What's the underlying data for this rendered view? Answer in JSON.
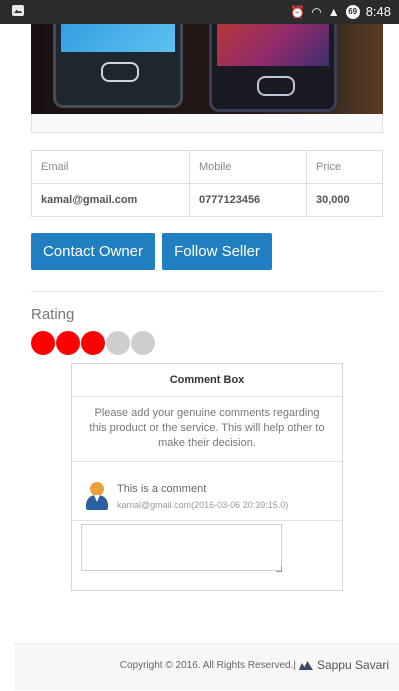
{
  "status_bar": {
    "time": "8:48",
    "battery_level": "69",
    "icons": [
      "image-icon",
      "alarm-icon",
      "wifi-icon",
      "signal-icon",
      "battery-icon"
    ]
  },
  "product": {
    "image_alt": "product-photo"
  },
  "table": {
    "headers": [
      "Email",
      "Mobile",
      "Price"
    ],
    "row": [
      "kamal@gmail.com",
      "0777123456",
      "30,000"
    ]
  },
  "actions": {
    "contact_label": "Contact Owner",
    "follow_label": "Follow Seller"
  },
  "rating": {
    "label": "Rating",
    "value": 3,
    "max": 5,
    "on_color": "#ff0000",
    "off_color": "#cfcfcf"
  },
  "comment_box": {
    "title": "Comment Box",
    "description": "Please add your genuine comments regarding this product or the service. This will help other to make their decision.",
    "comments": [
      {
        "text": "This is a comment",
        "meta": "kamal@gmail.com(2016-03-06 20:39:15.0)"
      }
    ],
    "input_value": ""
  },
  "footer": {
    "copyright": "Copyright © 2016. All Rights Reserved.|",
    "brand": "Sappu Savari"
  },
  "colors": {
    "accent": "#1f7fc0",
    "status_bar": "#2b2b2b"
  }
}
